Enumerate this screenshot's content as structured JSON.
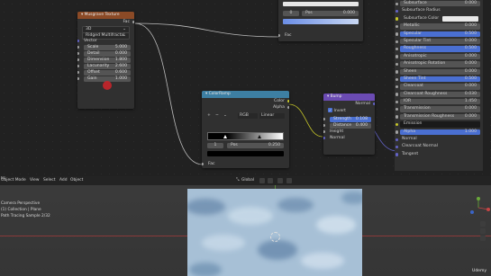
{
  "musgrave": {
    "title": "Musgrave Texture",
    "output": "Fac",
    "dimension_mode": "3D",
    "type": "Ridged Multifractal",
    "vector": "Vector",
    "fields": [
      {
        "label": "Scale",
        "value": "5.000"
      },
      {
        "label": "Detail",
        "value": "0.000"
      },
      {
        "label": "Dimension",
        "value": "1.800"
      },
      {
        "label": "Lacunarity",
        "value": "2.600"
      },
      {
        "label": "Offset",
        "value": "0.600"
      },
      {
        "label": "Gain",
        "value": "1.000"
      }
    ]
  },
  "colorramp_top": {
    "stop_index": "0",
    "pos_label": "Pos",
    "pos_value": "0.000",
    "fac": "Fac"
  },
  "colorramp": {
    "title": "ColorRamp",
    "outputs": [
      "Color",
      "Alpha"
    ],
    "add": "+",
    "remove": "−",
    "color_mode": "RGB",
    "interpolation": "Linear",
    "stop_index": "1",
    "pos_label": "Pos",
    "pos_value": "0.250",
    "input": "Fac"
  },
  "bump": {
    "title": "Bump",
    "output": "Normal",
    "invert_label": "Invert",
    "fields": [
      {
        "label": "Strength",
        "value": "0.108"
      },
      {
        "label": "Distance",
        "value": "0.400"
      }
    ],
    "inputs": [
      "Height",
      "Normal"
    ]
  },
  "principled": {
    "rows": [
      {
        "label": "Subsurface",
        "value": "0.000",
        "kind": "field",
        "sock": "gray"
      },
      {
        "label": "Subsurface Radius",
        "value": "",
        "kind": "plain",
        "sock": "purple"
      },
      {
        "label": "Subsurface Color",
        "value": "",
        "kind": "color",
        "sock": "yellow"
      },
      {
        "label": "Metallic",
        "value": "0.000",
        "kind": "field",
        "sock": "gray"
      },
      {
        "label": "Specular",
        "value": "0.500",
        "kind": "hl",
        "sock": "gray"
      },
      {
        "label": "Specular Tint",
        "value": "0.000",
        "kind": "field",
        "sock": "gray"
      },
      {
        "label": "Roughness",
        "value": "0.500",
        "kind": "hl",
        "sock": "gray"
      },
      {
        "label": "Anisotropic",
        "value": "0.000",
        "kind": "field",
        "sock": "gray"
      },
      {
        "label": "Anisotropic Rotation",
        "value": "0.000",
        "kind": "field",
        "sock": "gray"
      },
      {
        "label": "Sheen",
        "value": "0.000",
        "kind": "field",
        "sock": "gray"
      },
      {
        "label": "Sheen Tint",
        "value": "0.500",
        "kind": "hl",
        "sock": "gray"
      },
      {
        "label": "Clearcoat",
        "value": "0.000",
        "kind": "field",
        "sock": "gray"
      },
      {
        "label": "Clearcoat Roughness",
        "value": "0.030",
        "kind": "field",
        "sock": "gray"
      },
      {
        "label": "IOR",
        "value": "1.450",
        "kind": "field",
        "sock": "gray"
      },
      {
        "label": "Transmission",
        "value": "0.000",
        "kind": "field",
        "sock": "gray"
      },
      {
        "label": "Transmission Roughness",
        "value": "0.000",
        "kind": "field",
        "sock": "gray"
      },
      {
        "label": "Emission",
        "value": "",
        "kind": "dark",
        "sock": "yellow"
      },
      {
        "label": "Alpha",
        "value": "1.000",
        "kind": "hl",
        "sock": "gray"
      },
      {
        "label": "Normal",
        "value": "",
        "kind": "plain",
        "sock": "purple"
      },
      {
        "label": "Clearcoat Normal",
        "value": "",
        "kind": "plain",
        "sock": "purple"
      },
      {
        "label": "Tangent",
        "value": "",
        "kind": "plain",
        "sock": "purple"
      }
    ]
  },
  "viewport": {
    "mode": "Object Mode",
    "menus": [
      "View",
      "Select",
      "Add",
      "Object"
    ],
    "transform_orientation": "Global",
    "left_edge_label": "01",
    "overlay": [
      "Camera Perspective",
      "(1) Collection | Plane",
      "Path Tracing Sample 2/32"
    ],
    "watermark": "Udemy"
  },
  "colors": {
    "musgrave_header": "#8b4a26",
    "colorramp_header": "#3d7fa3",
    "bump_header": "#6b4bb3",
    "accent_field": "#4a6fd1",
    "link": "#bfbfbf"
  }
}
